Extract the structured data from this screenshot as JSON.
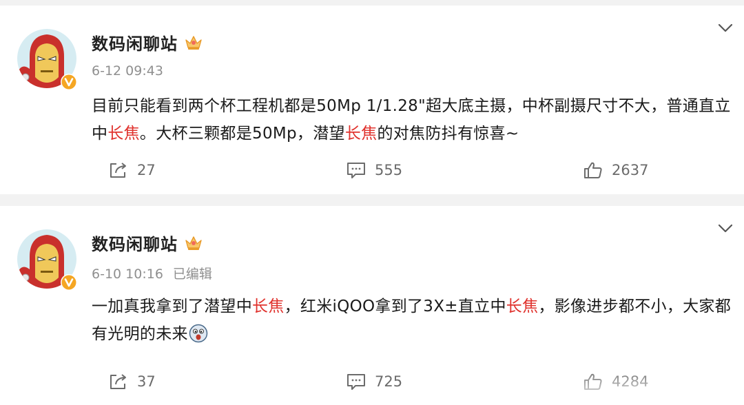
{
  "colors": {
    "background": "#f2f2f2",
    "card": "#ffffff",
    "highlight": "#e0322d",
    "meta": "#8f8f8f",
    "verified_badge": "#f5a623"
  },
  "posts": [
    {
      "author": "数码闲聊站",
      "date": "6-12 09:43",
      "edited": "",
      "content": {
        "part1": "目前只能看到两个杯工程机都是50Mp 1/1.28\"超大底主摄，中杯副摄尺寸不大，普通直立中",
        "hl1": "长焦",
        "part2": "。大杯三颗都是50Mp，潜望",
        "hl2": "长焦",
        "part3": "的对焦防抖有惊喜~"
      },
      "reposts": "27",
      "comments": "555",
      "likes": "2637",
      "icons": [
        "crown-icon",
        "verified-badge-icon",
        "chevron-down-icon",
        "repost-icon",
        "comment-icon",
        "like-icon"
      ]
    },
    {
      "author": "数码闲聊站",
      "date": "6-10 10:16",
      "edited": "已编辑",
      "content": {
        "part1": "一加真我拿到了潜望中",
        "hl1": "长焦",
        "part2": "，红米iQOO拿到了3X±直立中",
        "hl2": "长焦",
        "part3": "，影像进步都不小，大家都有光明的未来"
      },
      "reposts": "37",
      "comments": "725",
      "likes": "4284",
      "icons": [
        "crown-icon",
        "verified-badge-icon",
        "chevron-down-icon",
        "repost-icon",
        "comment-icon",
        "like-icon",
        "emoji-icon"
      ]
    }
  ]
}
